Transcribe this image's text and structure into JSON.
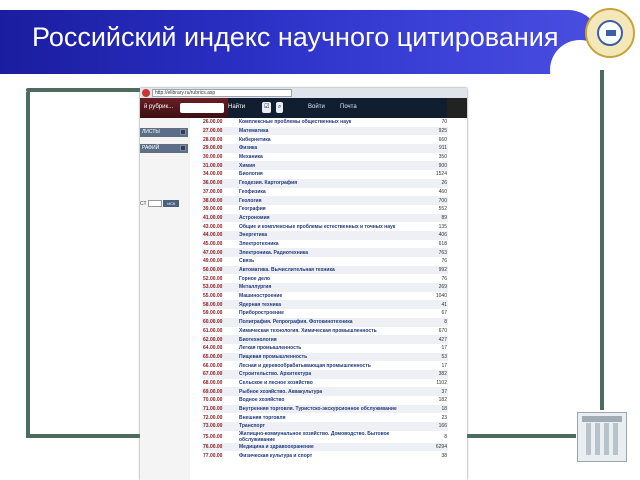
{
  "slide": {
    "title": "Российский индекс научного цитирования"
  },
  "browser": {
    "url": "http://elibrary.ru/rubrics.asp",
    "find_label": "Найти",
    "toolbar_items": [
      "Войти",
      "Почта"
    ],
    "tab_label": "й рубрик..."
  },
  "sidebar": {
    "buttons": [
      "ЛИСТЫ",
      "РАФИЙ"
    ],
    "search_label": "СТ",
    "search_go": "ИСК"
  },
  "rubrics": [
    {
      "code": "26.00.00",
      "name": "Комплексные проблемы общественных наук",
      "count": "70"
    },
    {
      "code": "27.00.00",
      "name": "Математика",
      "count": "925"
    },
    {
      "code": "28.00.00",
      "name": "Кибернетика",
      "count": "660"
    },
    {
      "code": "29.00.00",
      "name": "Физика",
      "count": "911"
    },
    {
      "code": "30.00.00",
      "name": "Механика",
      "count": "350"
    },
    {
      "code": "31.00.00",
      "name": "Химия",
      "count": "900"
    },
    {
      "code": "34.00.00",
      "name": "Биология",
      "count": "1524"
    },
    {
      "code": "36.00.00",
      "name": "Геодезия. Картография",
      "count": "26"
    },
    {
      "code": "37.00.00",
      "name": "Геофизика",
      "count": "460"
    },
    {
      "code": "38.00.00",
      "name": "Геология",
      "count": "700"
    },
    {
      "code": "39.00.00",
      "name": "География",
      "count": "552"
    },
    {
      "code": "41.00.00",
      "name": "Астрономия",
      "count": "89"
    },
    {
      "code": "43.00.00",
      "name": "Общие и комплексные проблемы естественных и точных наук",
      "count": "135"
    },
    {
      "code": "44.00.00",
      "name": "Энергетика",
      "count": "406"
    },
    {
      "code": "45.00.00",
      "name": "Электротехника",
      "count": "618"
    },
    {
      "code": "47.00.00",
      "name": "Электроника. Радиотехника",
      "count": "763"
    },
    {
      "code": "49.00.00",
      "name": "Связь",
      "count": "76"
    },
    {
      "code": "50.00.00",
      "name": "Автоматика. Вычислительная техника",
      "count": "992"
    },
    {
      "code": "52.00.00",
      "name": "Горное дело",
      "count": "76"
    },
    {
      "code": "53.00.00",
      "name": "Металлургия",
      "count": "269"
    },
    {
      "code": "55.00.00",
      "name": "Машиностроение",
      "count": "1040"
    },
    {
      "code": "58.00.00",
      "name": "Ядерная техника",
      "count": "41"
    },
    {
      "code": "59.00.00",
      "name": "Приборостроение",
      "count": "67"
    },
    {
      "code": "60.00.00",
      "name": "Полиграфия. Репрография. Фотокинотехника",
      "count": "8"
    },
    {
      "code": "61.00.00",
      "name": "Химическая технология. Химическая промышленность",
      "count": "670"
    },
    {
      "code": "62.00.00",
      "name": "Биотехнология",
      "count": "427"
    },
    {
      "code": "64.00.00",
      "name": "Легкая промышленность",
      "count": "17"
    },
    {
      "code": "65.00.00",
      "name": "Пищевая промышленность",
      "count": "53"
    },
    {
      "code": "66.00.00",
      "name": "Лесная и деревообрабатывающая промышленность",
      "count": "17"
    },
    {
      "code": "67.00.00",
      "name": "Строительство. Архитектура",
      "count": "382"
    },
    {
      "code": "68.00.00",
      "name": "Сельское и лесное хозяйство",
      "count": "1102"
    },
    {
      "code": "69.00.00",
      "name": "Рыбное хозяйство. Аквакультура",
      "count": "37"
    },
    {
      "code": "70.00.00",
      "name": "Водное хозяйство",
      "count": "182"
    },
    {
      "code": "71.00.00",
      "name": "Внутренняя торговля. Туристско-экскурсионное обслуживание",
      "count": "18"
    },
    {
      "code": "72.00.00",
      "name": "Внешняя торговля",
      "count": "23"
    },
    {
      "code": "73.00.00",
      "name": "Транспорт",
      "count": "166"
    },
    {
      "code": "75.00.00",
      "name": "Жилищно-коммунальное хозяйство. Домоводство. Бытовое обслуживание",
      "count": "8",
      "tall": true
    },
    {
      "code": "76.00.00",
      "name": "Медицина и здравоохранение",
      "count": "6294"
    },
    {
      "code": "77.00.00",
      "name": "Физическая культура и спорт",
      "count": "38"
    }
  ]
}
